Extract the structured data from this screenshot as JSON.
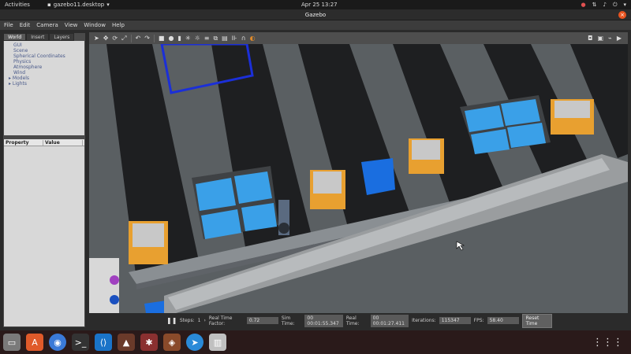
{
  "topbar": {
    "activities": "Activities",
    "app_name": "gazebo11.desktop",
    "clock": "Apr 25  13:27"
  },
  "window": {
    "title": "Gazebo"
  },
  "menu": [
    "File",
    "Edit",
    "Camera",
    "View",
    "Window",
    "Help"
  ],
  "panel": {
    "tabs": [
      "World",
      "Insert",
      "Layers"
    ],
    "tree": [
      "GUI",
      "Scene",
      "Spherical Coordinates",
      "Physics",
      "Atmosphere",
      "Wind",
      "Models",
      "Lights"
    ],
    "prop_headers": [
      "Property",
      "Value"
    ]
  },
  "status": {
    "steps_label": "Steps:",
    "steps_value": "1",
    "rtf_label": "Real Time Factor:",
    "rtf_value": "0.72",
    "sim_label": "Sim Time:",
    "sim_value": "00 00:01:55.347",
    "real_label": "Real Time:",
    "real_value": "00 00:01:27.411",
    "iter_label": "Iterations:",
    "iter_value": "115347",
    "fps_label": "FPS:",
    "fps_value": "58.40",
    "reset": "Reset Time"
  }
}
